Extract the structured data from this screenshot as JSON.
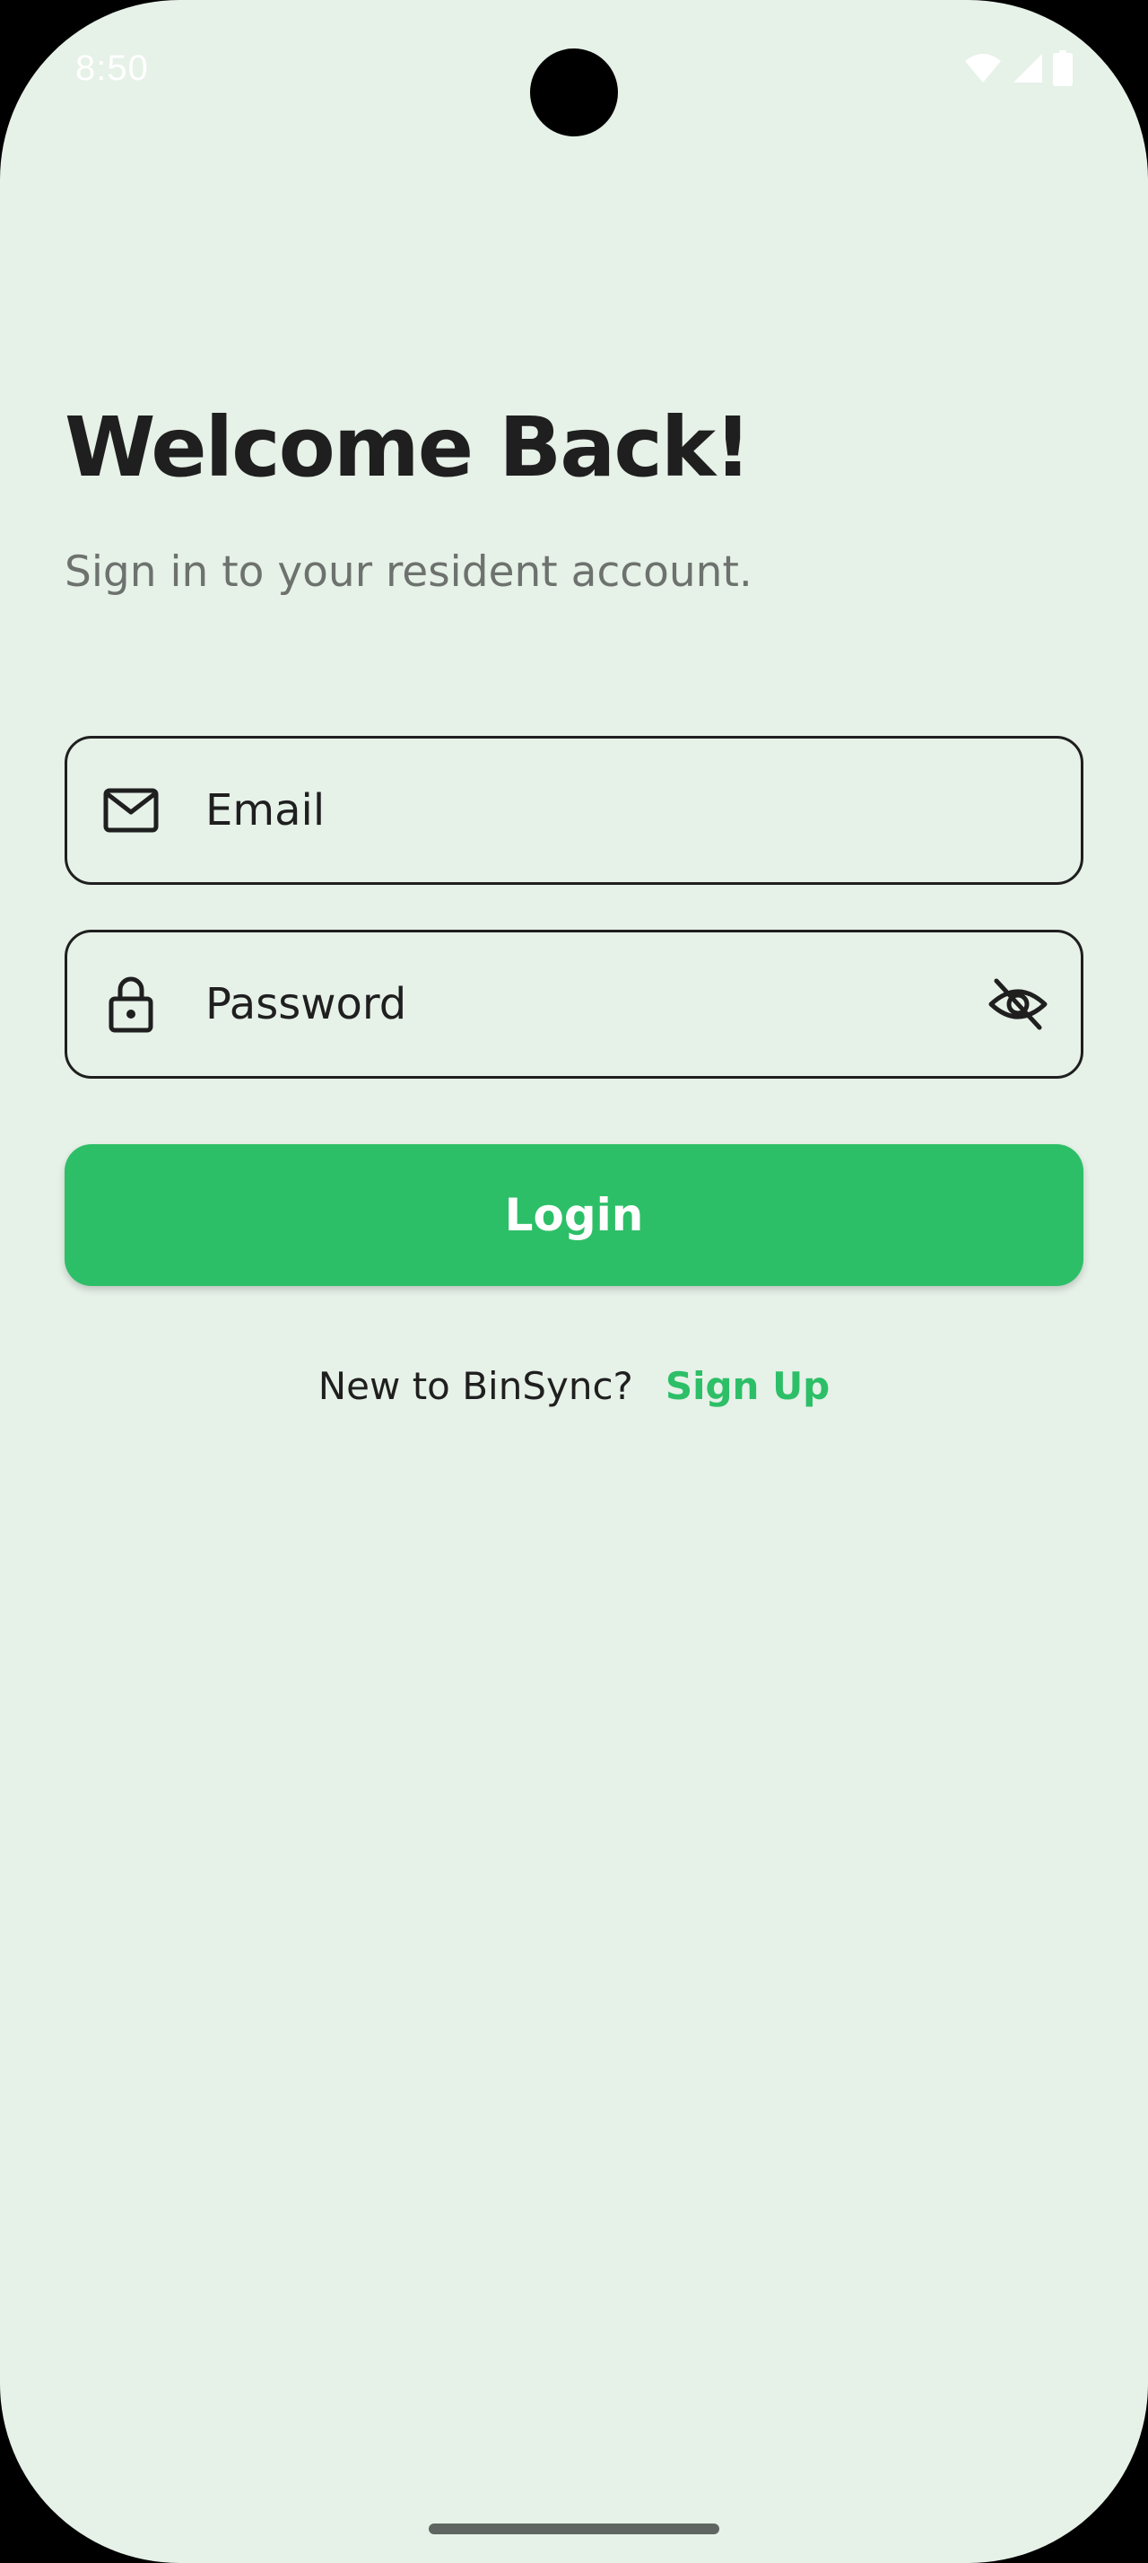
{
  "status_bar": {
    "time": "8:50",
    "icons": [
      "wifi-icon",
      "cellular-signal-icon",
      "battery-icon"
    ]
  },
  "header": {
    "title": "Welcome Back!",
    "subtitle": "Sign in to your resident account."
  },
  "form": {
    "email": {
      "placeholder": "Email",
      "value": "",
      "icon": "mail-icon"
    },
    "password": {
      "placeholder": "Password",
      "value": "",
      "icon": "lock-icon",
      "toggle_icon": "eye-off-icon"
    },
    "login_label": "Login"
  },
  "footer": {
    "prompt": "New to BinSync?",
    "signup_label": "Sign Up"
  },
  "colors": {
    "background": "#e6f1e8",
    "accent": "#2dbf67",
    "text": "#1f1f1f",
    "muted_text": "#6d726e"
  }
}
